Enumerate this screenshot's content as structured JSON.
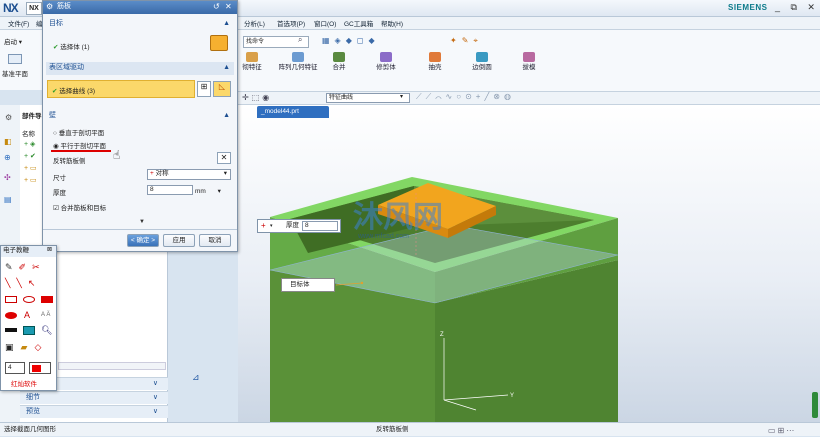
{
  "app": {
    "logo": "NX",
    "tab": "NX",
    "brand": "SIEMENS",
    "window_controls": "_ ⧉ ✕"
  },
  "menu": [
    "文件(F)",
    "编",
    "分析(L)",
    "首选项(P)",
    "窗口(O)",
    "GC工具箱",
    "帮助(H)"
  ],
  "left_ribbon": {
    "start": "启动 ▾",
    "datum_plane": "基准平面"
  },
  "ribbon": {
    "search_placeholder": "找命令",
    "items": [
      "彻特征",
      "阵列几何特征",
      "合并",
      "修剪体",
      "抽壳",
      "边倒圆",
      "拔模"
    ]
  },
  "selection_bar": {
    "filter": "特征曲线"
  },
  "file_tab": "_model44.prt",
  "nav": {
    "title": "部件导",
    "col_name": "名称",
    "sections": [
      "细节",
      "预览"
    ]
  },
  "dialog": {
    "title": "筋板",
    "target_section": "目标",
    "select_body": "选择体 (1)",
    "table_section": "表区域驱动",
    "select_curve": "选择曲线 (3)",
    "wall_section": "壁",
    "radio_perp": "垂直于剖切平面",
    "radio_parallel": "平行于剖切平面",
    "reverse_dir": "反转筋板侧",
    "size_label": "尺寸",
    "size_value": "对称",
    "thickness_label": "厚度",
    "thickness_value": "8",
    "thickness_unit": "mm",
    "combine": "合并筋板和目标",
    "ok": "< 确定 >",
    "apply": "应用",
    "cancel": "取消"
  },
  "palette": {
    "title": "电子教鞭",
    "size": "4",
    "brand": "红灿软件"
  },
  "graphics": {
    "dyn_label": "厚度",
    "dyn_value": "8",
    "target_label": "目标体",
    "watermark": "沐风网",
    "watermark_url": "www.mfcad.com"
  },
  "status": {
    "left": "选择截面几何图形",
    "center": "反转筋板侧"
  },
  "colors": {
    "body": "#5f9a3a",
    "rim": "#7fd15e",
    "rib": "#f0a020",
    "accent": "#2f6fc0"
  }
}
